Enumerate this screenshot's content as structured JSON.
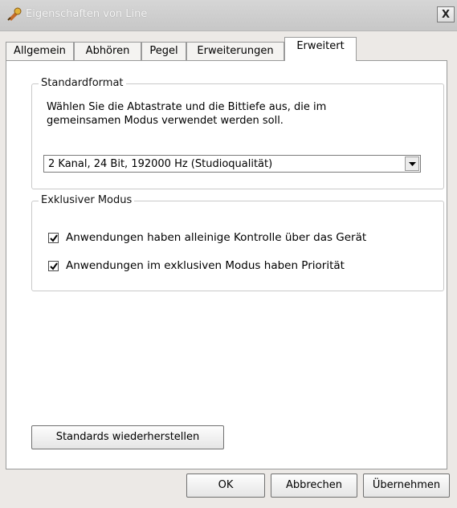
{
  "window": {
    "title": "Eigenschaften von Line",
    "close_label": "X"
  },
  "tabs": [
    {
      "label": "Allgemein",
      "active": false
    },
    {
      "label": "Abhören",
      "active": false
    },
    {
      "label": "Pegel",
      "active": false
    },
    {
      "label": "Erweiterungen",
      "active": false
    },
    {
      "label": "Erweitert",
      "active": true
    }
  ],
  "standard_format": {
    "group_label": "Standardformat",
    "description_line1": "Wählen Sie die Abtastrate und die Bittiefe aus, die im",
    "description_line2": "gemeinsamen Modus verwendet werden soll.",
    "selected_value": "2 Kanal, 24 Bit, 192000 Hz (Studioqualität)"
  },
  "exclusive_mode": {
    "group_label": "Exklusiver Modus",
    "options": [
      {
        "label": "Anwendungen haben alleinige Kontrolle über das Gerät",
        "checked": true
      },
      {
        "label": "Anwendungen im exklusiven Modus haben Priorität",
        "checked": true
      }
    ]
  },
  "restore_button": "Standards wiederherstellen",
  "buttons": {
    "ok": "OK",
    "cancel": "Abbrechen",
    "apply": "Übernehmen"
  }
}
